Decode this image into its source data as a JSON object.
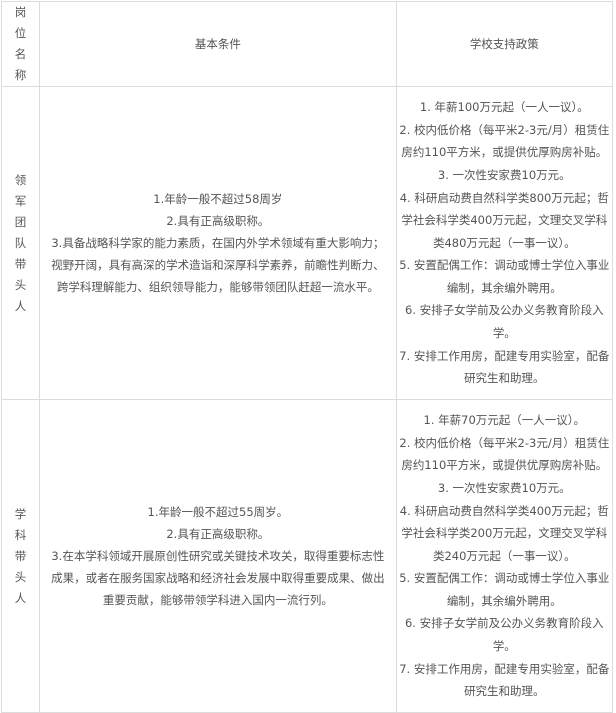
{
  "table": {
    "headers": {
      "position": "岗位名称",
      "conditions": "基本条件",
      "policy": "学校支持政策"
    },
    "rows": [
      {
        "position": "领军团队带头人",
        "conditions": [
          "1.年龄一般不超过58周岁",
          "2.具有正高级职称。",
          "3.具备战略科学家的能力素质，在国内外学术领域有重大影响力；视野开阔，具有高深的学术造诣和深厚科学素养，前瞻性判断力、跨学科理解能力、组织领导能力，能够带领团队赶超一流水平。"
        ],
        "policy": [
          "1. 年薪100万元起（一人一议）。",
          "2. 校内低价格（每平米2-3元/月）租赁住房约110平方米，或提供优厚购房补贴。",
          "3. 一次性安家费10万元。",
          "4. 科研启动费自然科学类800万元起；哲学社会科学类400万元起，文理交叉学科类480万元起（一事一议）。",
          "5. 安置配偶工作：调动或博士学位入事业编制，其余编外聘用。",
          "6. 安排子女学前及公办义务教育阶段入学。",
          "7. 安排工作用房，配建专用实验室，配备研究生和助理。"
        ]
      },
      {
        "position": "学科带头人",
        "conditions": [
          "1.年龄一般不超过55周岁。",
          "2.具有正高级职称。",
          "3.在本学科领域开展原创性研究或关键技术攻关，取得重要标志性成果，或者在服务国家战略和经济社会发展中取得重要成果、做出重要贡献，能够带领学科进入国内一流行列。"
        ],
        "policy": [
          "1. 年薪70万元起（一人一议）。",
          "2. 校内低价格（每平米2-3元/月）租赁住房约110平方米，或提供优厚购房补贴。",
          "3. 一次性安家费10万元。",
          "4. 科研启动费自然科学类400万元起；哲学社会科学类200万元起，文理交叉学科类240万元起（一事一议）。",
          "5. 安置配偶工作：调动或博士学位入事业编制，其余编外聘用。",
          "6. 安排子女学前及公办义务教育阶段入学。",
          "7. 安排工作用房，配建专用实验室，配备研究生和助理。"
        ]
      }
    ]
  }
}
